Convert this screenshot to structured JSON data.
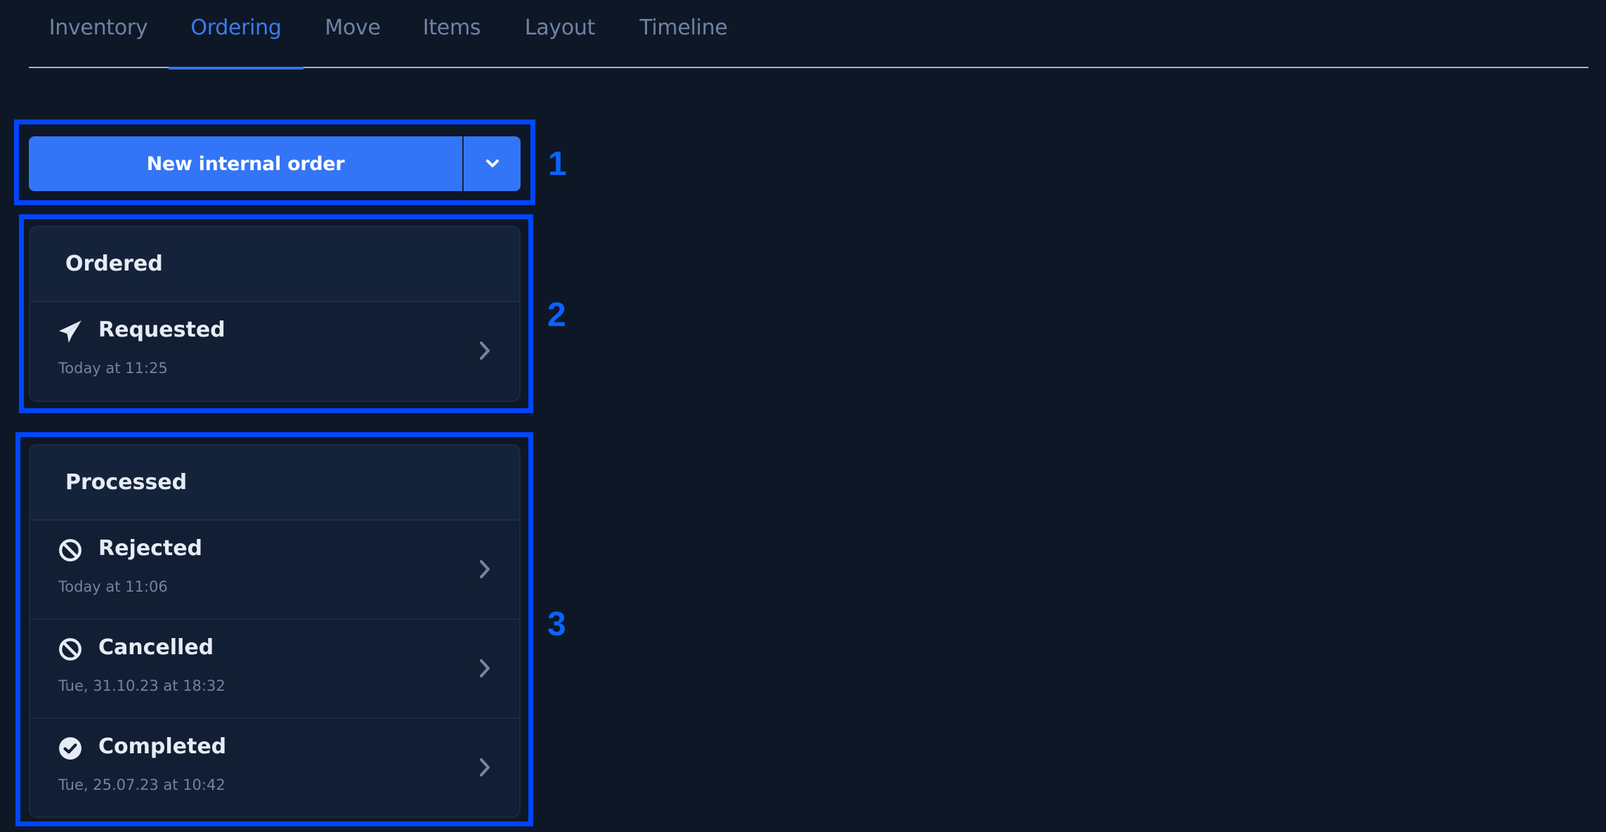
{
  "tabs": [
    {
      "label": "Inventory",
      "active": false
    },
    {
      "label": "Ordering",
      "active": true
    },
    {
      "label": "Move",
      "active": false
    },
    {
      "label": "Items",
      "active": false
    },
    {
      "label": "Layout",
      "active": false
    },
    {
      "label": "Timeline",
      "active": false
    }
  ],
  "new_order": {
    "label": "New internal order",
    "toggle_icon": "chevron-down-icon"
  },
  "sections": [
    {
      "title": "Ordered",
      "rows": [
        {
          "icon": "paper-plane-icon",
          "title": "Requested",
          "date": "Today at 11:25"
        }
      ]
    },
    {
      "title": "Processed",
      "rows": [
        {
          "icon": "ban-icon",
          "title": "Rejected",
          "date": "Today at 11:06"
        },
        {
          "icon": "ban-icon",
          "title": "Cancelled",
          "date": "Tue, 31.10.23 at 18:32"
        },
        {
          "icon": "check-circle-icon",
          "title": "Completed",
          "date": "Tue, 25.07.23 at 10:42"
        }
      ]
    }
  ],
  "annotations": [
    "1",
    "2",
    "3"
  ],
  "colors": {
    "accent": "#3375f6",
    "highlight": "#0046ff",
    "background": "#0e1726"
  }
}
